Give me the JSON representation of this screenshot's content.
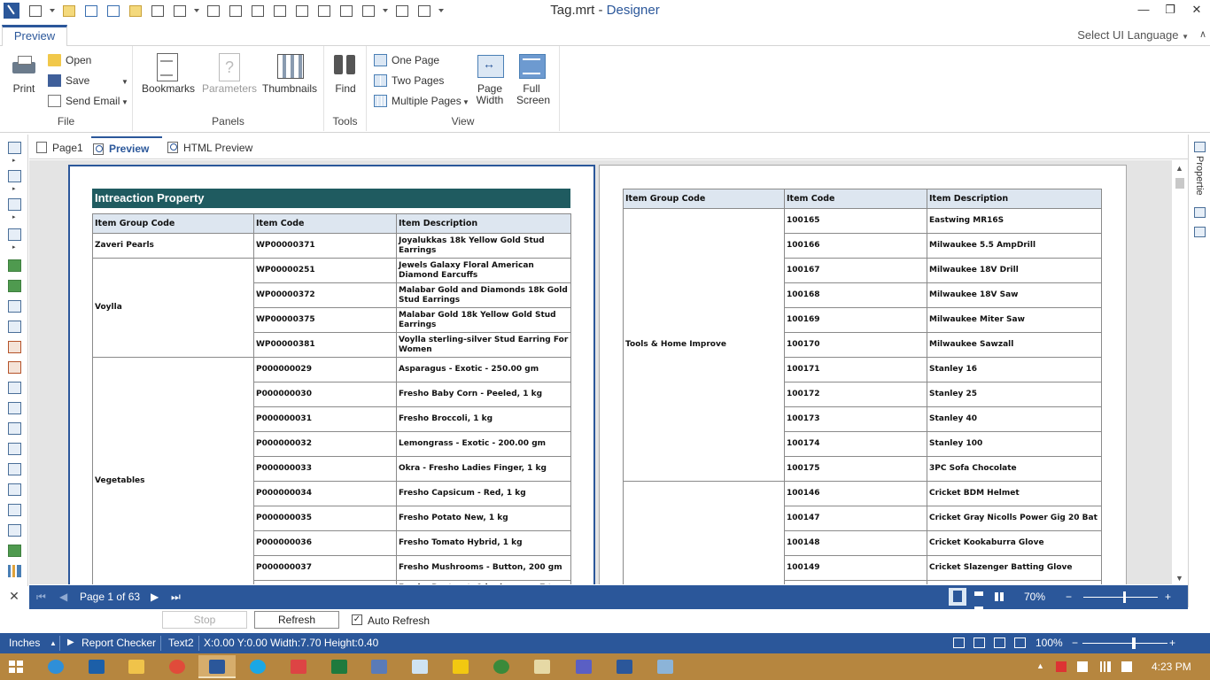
{
  "window": {
    "filename": "Tag.mrt",
    "separator": " - ",
    "app_name": "Designer",
    "minimize": "—",
    "restore": "❐",
    "close": "✕"
  },
  "ribbon": {
    "active_tab": "Preview",
    "ui_language": "Select UI Language",
    "groups": {
      "file": {
        "label": "File",
        "print": "Print",
        "open": "Open",
        "save": "Save",
        "send_email": "Send Email"
      },
      "panels": {
        "label": "Panels",
        "bookmarks": "Bookmarks",
        "parameters": "Parameters",
        "thumbnails": "Thumbnails"
      },
      "tools": {
        "label": "Tools",
        "find": "Find"
      },
      "view": {
        "label": "View",
        "one_page": "One Page",
        "two_pages": "Two Pages",
        "multiple_pages": "Multiple Pages",
        "page_width_1": "Page",
        "page_width_2": "Width",
        "full_screen_1": "Full",
        "full_screen_2": "Screen"
      }
    }
  },
  "doc_tabs": {
    "page1": "Page1",
    "preview": "Preview",
    "html_preview": "HTML Preview"
  },
  "right_panel": {
    "label": "Propertie"
  },
  "report": {
    "title": "Intreaction Property",
    "headers": {
      "group": "Item Group Code",
      "code": "Item Code",
      "desc": "Item Description"
    },
    "left_groups": [
      {
        "name": "Zaveri Pearls",
        "rows": [
          {
            "code": "WP00000371",
            "desc": "Joyalukkas 18k Yellow Gold Stud Earrings"
          }
        ]
      },
      {
        "name": "Voylla",
        "rows": [
          {
            "code": "WP00000251",
            "desc": "Jewels Galaxy Floral American Diamond Earcuffs"
          },
          {
            "code": "WP00000372",
            "desc": "Malabar Gold and Diamonds 18k Gold Stud Earrings"
          },
          {
            "code": "WP00000375",
            "desc": "Malabar Gold 18k Yellow Gold Stud Earrings"
          },
          {
            "code": "WP00000381",
            "desc": "Voylla sterling-silver Stud Earring For Women"
          }
        ]
      },
      {
        "name": "Vegetables",
        "rows": [
          {
            "code": "P000000029",
            "desc": "Asparagus - Exotic - 250.00 gm"
          },
          {
            "code": "P000000030",
            "desc": "Fresho Baby Corn - Peeled, 1 kg"
          },
          {
            "code": "P000000031",
            "desc": "Fresho Broccoli, 1 kg"
          },
          {
            "code": "P000000032",
            "desc": "Lemongrass - Exotic - 200.00 gm"
          },
          {
            "code": "P000000033",
            "desc": "Okra - Fresho Ladies Finger, 1 kg"
          },
          {
            "code": "P000000034",
            "desc": "Fresho Capsicum - Red, 1 kg"
          },
          {
            "code": "P000000035",
            "desc": "Fresho Potato New, 1 kg"
          },
          {
            "code": "P000000036",
            "desc": "Fresho Tomato Hybrid, 1 kg"
          },
          {
            "code": "P000000037",
            "desc": "Fresho Mushrooms - Button, 200 gm"
          },
          {
            "code": "",
            "desc": "Fresho Beetroot, 1 kg (approx. 7 to 8..."
          }
        ]
      }
    ],
    "right_groups": [
      {
        "name": "Tools & Home Improve",
        "rows": [
          {
            "code": "100165",
            "desc": "Eastwing MR16S"
          },
          {
            "code": "100166",
            "desc": "Milwaukee 5.5 AmpDrill"
          },
          {
            "code": "100167",
            "desc": "Milwaukee 18V Drill"
          },
          {
            "code": "100168",
            "desc": "Milwaukee 18V Saw"
          },
          {
            "code": "100169",
            "desc": "Milwaukee Miter Saw"
          },
          {
            "code": "100170",
            "desc": "Milwaukee Sawzall"
          },
          {
            "code": "100171",
            "desc": "Stanley 16"
          },
          {
            "code": "100172",
            "desc": "Stanley 25"
          },
          {
            "code": "100173",
            "desc": "Stanley 40"
          },
          {
            "code": "100174",
            "desc": "Stanley 100"
          },
          {
            "code": "100175",
            "desc": "3PC Sofa Chocolate"
          }
        ]
      },
      {
        "name": "",
        "rows": [
          {
            "code": "100146",
            "desc": "Cricket BDM Helmet"
          },
          {
            "code": "100147",
            "desc": "Cricket Gray Nicolls Power Gig 20 Bat"
          },
          {
            "code": "100148",
            "desc": "Cricket Kookaburra Glove"
          },
          {
            "code": "100149",
            "desc": "Cricket Slazenger Batting Glove"
          },
          {
            "code": "",
            "desc": ""
          }
        ]
      }
    ]
  },
  "navigation": {
    "page_indicator": "Page 1 of 63",
    "zoom": "70%",
    "zoom_fraction": 0.55,
    "minus": "−",
    "plus": "+"
  },
  "refresh_row": {
    "stop": "Stop",
    "refresh": "Refresh",
    "auto_refresh": "Auto Refresh",
    "auto_refresh_checked": "✓"
  },
  "statusbar": {
    "units": "Inches",
    "report_checker": "Report Checker",
    "component": "Text2",
    "coords": "X:0.00  Y:0.00  Width:7.70  Height:0.40",
    "zoom": "100%",
    "zoom_fraction": 0.6,
    "minus": "−",
    "plus": "+"
  },
  "taskbar": {
    "time": "4:23 PM",
    "colors": {
      "background": "#b6863f"
    }
  },
  "colors": {
    "accent": "#2b579a",
    "report_title_bg": "#1f5b60",
    "header_bg": "#dde6f0"
  }
}
